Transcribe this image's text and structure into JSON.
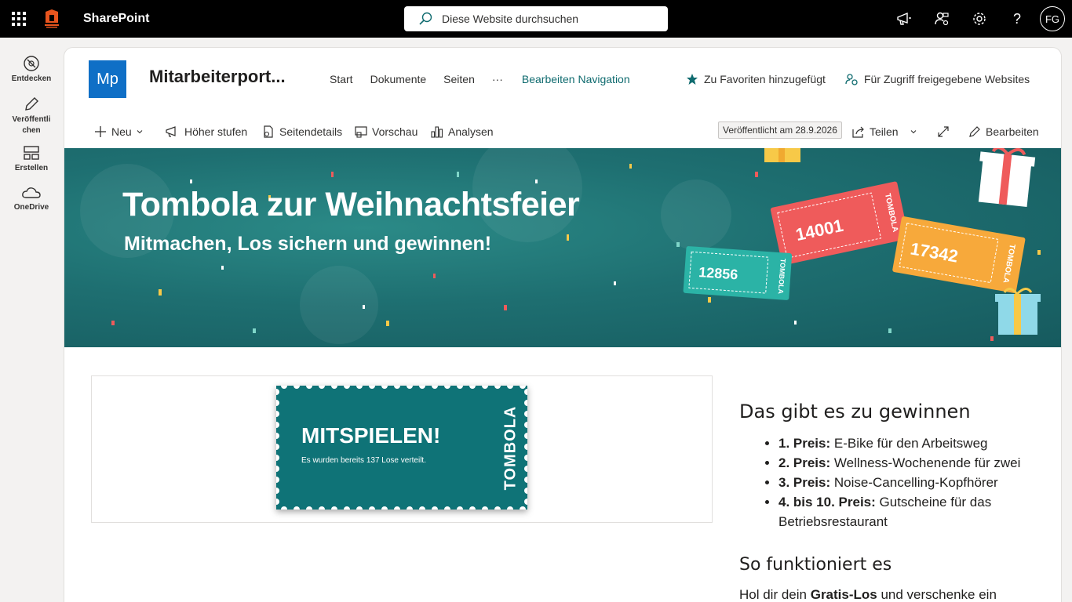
{
  "suite": {
    "app_name": "SharePoint",
    "search_placeholder": "Diese Website durchsuchen",
    "avatar_initials": "FG"
  },
  "appbar": {
    "items": [
      {
        "label": "Entdecken"
      },
      {
        "label": "Veröffentli chen"
      },
      {
        "label": "Erstellen"
      },
      {
        "label": "OneDrive"
      }
    ]
  },
  "site": {
    "logo_text": "Mp",
    "title": "Mitarbeiterport...",
    "nav": [
      "Start",
      "Dokumente",
      "Seiten",
      "···"
    ],
    "nav_edit": "Bearbeiten Navigation",
    "favorite": "Zu Favoriten hinzugefügt",
    "shared": "Für Zugriff freigegebene Websites"
  },
  "commands": {
    "new": "Neu",
    "promote": "Höher stufen",
    "details": "Seitendetails",
    "preview": "Vorschau",
    "analytics": "Analysen",
    "published": "Veröffentlicht am 28.9.2026",
    "share": "Teilen",
    "edit": "Bearbeiten"
  },
  "hero": {
    "title": "Tombola zur Weihnachtsfeier",
    "subtitle": "Mitmachen, Los sichern und gewinnen!",
    "tickets": [
      {
        "number": "14001",
        "label": "TOMBOLA",
        "color": "#ef5b5b"
      },
      {
        "number": "17342",
        "label": "TOMBOLA",
        "color": "#f7a93b"
      },
      {
        "number": "12856",
        "label": "TOMBOLA",
        "color": "#2bb3a6"
      }
    ]
  },
  "ticket": {
    "title": "MITSPIELEN!",
    "subtitle": "Es wurden bereits 137 Lose verteilt.",
    "side_label": "TOMBOLA",
    "color": "#0f7377"
  },
  "prizes": {
    "heading": "Das gibt es zu gewinnen",
    "items": [
      {
        "rank": "1. Preis:",
        "text": " E-Bike für den Arbeitsweg"
      },
      {
        "rank": "2. Preis:",
        "text": " Wellness-Wochenende für zwei"
      },
      {
        "rank": "3. Preis:",
        "text": " Noise-Cancelling-Kopfhörer"
      },
      {
        "rank": "4. bis 10. Preis:",
        "text": " Gutscheine für das Betriebsrestaurant"
      }
    ],
    "howto_heading": "So funktioniert es",
    "howto_text_1": "Hol dir dein ",
    "howto_bold": "Gratis-Los",
    "howto_text_2": " und verschenke ein"
  },
  "colors": {
    "accent": "#0f6b6f",
    "brand_blue": "#0f6fc6",
    "hero_teal": "#1e6f71"
  }
}
